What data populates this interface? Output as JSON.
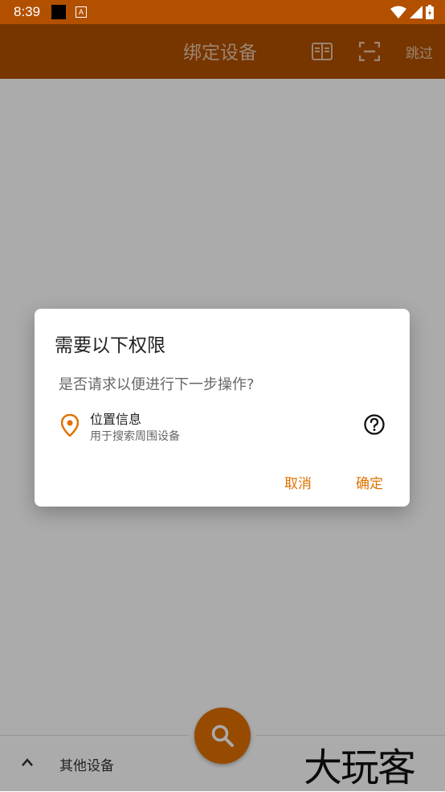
{
  "status_bar": {
    "time": "8:39",
    "notification_icon_label": "A"
  },
  "app_bar": {
    "title": "绑定设备",
    "skip_label": "跳过",
    "icons": [
      "book-icon",
      "scan-icon"
    ]
  },
  "bottom": {
    "other_devices_label": "其他设备",
    "watermark": "大玩客"
  },
  "dialog": {
    "title": "需要以下权限",
    "message": "是否请求以便进行下一步操作?",
    "permission": {
      "name": "位置信息",
      "description": "用于搜索周围设备",
      "icon": "location-pin-icon"
    },
    "cancel_label": "取消",
    "ok_label": "确定"
  },
  "colors": {
    "primary": "#B25000",
    "accent": "#E17100"
  }
}
